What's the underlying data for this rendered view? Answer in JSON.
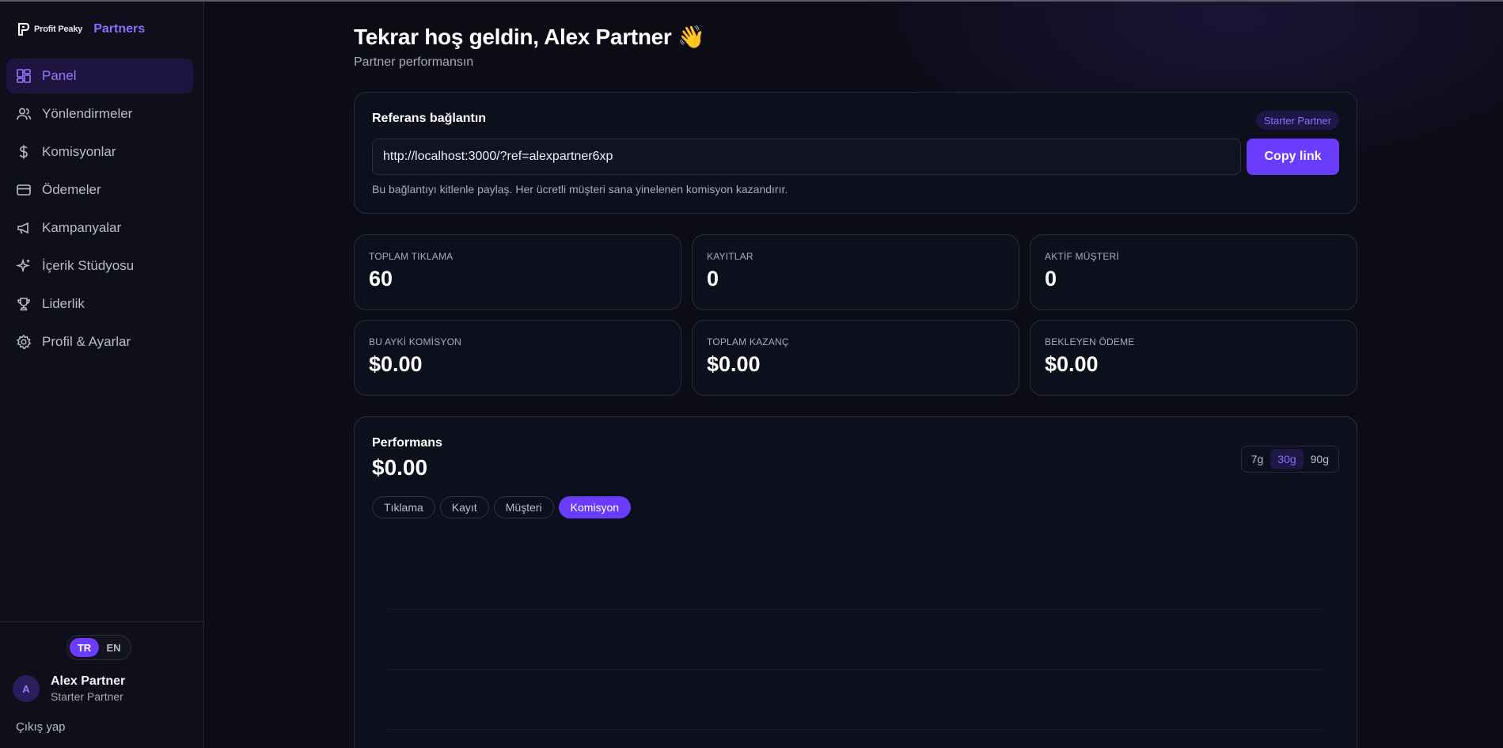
{
  "brand": {
    "name": "Profit Peaky",
    "product": "Partners",
    "logo_icon": "profit-peaky-logo-icon"
  },
  "sidebar": {
    "items": [
      {
        "label": "Panel",
        "icon": "dashboard-icon",
        "active": true
      },
      {
        "label": "Yönlendirmeler",
        "icon": "users-icon"
      },
      {
        "label": "Komisyonlar",
        "icon": "dollar-icon"
      },
      {
        "label": "Ödemeler",
        "icon": "credit-card-icon"
      },
      {
        "label": "Kampanyalar",
        "icon": "megaphone-icon"
      },
      {
        "label": "İçerik Stüdyosu",
        "icon": "sparkles-icon"
      },
      {
        "label": "Liderlik",
        "icon": "trophy-icon"
      },
      {
        "label": "Profil & Ayarlar",
        "icon": "gear-icon"
      }
    ],
    "language": {
      "options": [
        "TR",
        "EN"
      ],
      "selected": "TR"
    },
    "user": {
      "initial": "A",
      "name": "Alex Partner",
      "plan": "Starter Partner"
    },
    "logout_label": "Çıkış yap"
  },
  "header": {
    "title": "Tekrar hoş geldin, Alex Partner 👋",
    "subtitle": "Partner performansın"
  },
  "referral": {
    "title": "Referans bağlantın",
    "badge": "Starter Partner",
    "link": "http://localhost:3000/?ref=alexpartner6xp",
    "copy_label": "Copy link",
    "help": "Bu bağlantıyı kitlenle paylaş. Her ücretli müşteri sana yinelenen komisyon kazandırır."
  },
  "stats": [
    {
      "label": "TOPLAM TIKLAMA",
      "value": "60"
    },
    {
      "label": "KAYITLAR",
      "value": "0"
    },
    {
      "label": "AKTİF MÜŞTERİ",
      "value": "0"
    },
    {
      "label": "BU AYKİ KOMİSYON",
      "value": "$0.00"
    },
    {
      "label": "TOPLAM KAZANÇ",
      "value": "$0.00"
    },
    {
      "label": "BEKLEYEN ÖDEME",
      "value": "$0.00"
    }
  ],
  "performance": {
    "title": "Performans",
    "value": "$0.00",
    "ranges": [
      "7g",
      "30g",
      "90g"
    ],
    "selected_range": "30g",
    "metrics": [
      "Tıklama",
      "Kayıt",
      "Müşteri",
      "Komisyon"
    ],
    "selected_metric": "Komisyon"
  },
  "colors": {
    "accent": "#6a3cff",
    "accent_text": "#8f6bff",
    "background": "#0b0c16",
    "card": "#0e0f1c"
  }
}
